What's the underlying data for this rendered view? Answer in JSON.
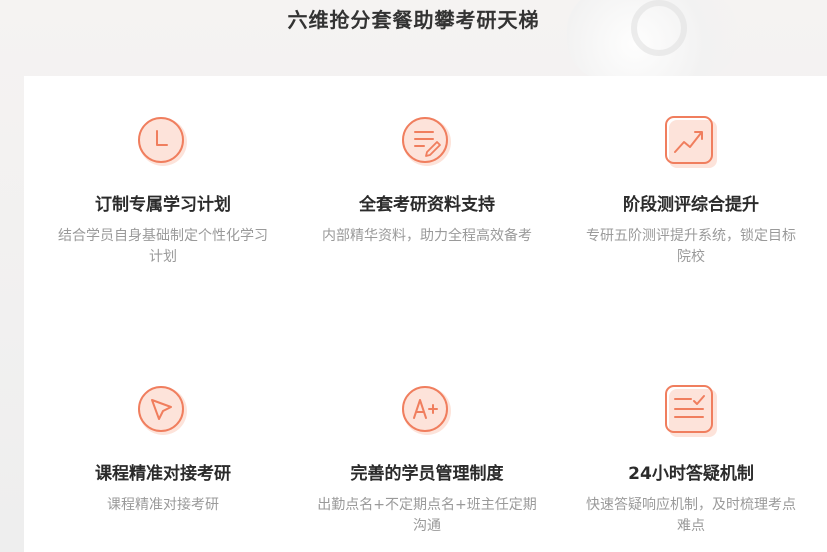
{
  "title": "六维抢分套餐助攀考研天梯",
  "features": [
    {
      "icon": "clock-icon",
      "title": "订制专属学习计划",
      "desc": "结合学员自身基础制定个性化学习计划"
    },
    {
      "icon": "document-edit-icon",
      "title": "全套考研资料支持",
      "desc": "内部精华资料，助力全程高效备考"
    },
    {
      "icon": "trend-chart-icon",
      "title": "阶段测评综合提升",
      "desc": "专研五阶测评提升系统，锁定目标院校"
    },
    {
      "icon": "cursor-icon",
      "title": "课程精准对接考研",
      "desc": "课程精准对接考研"
    },
    {
      "icon": "grade-a-plus-icon",
      "title": "完善的学员管理制度",
      "desc": "出勤点名+不定期点名+班主任定期沟通"
    },
    {
      "icon": "checklist-icon",
      "title": "24小时答疑机制",
      "desc": "快速答疑响应机制，及时梳理考点难点"
    }
  ],
  "colors": {
    "accent": "#f07e5e",
    "icon_bg": "#fde3da"
  }
}
